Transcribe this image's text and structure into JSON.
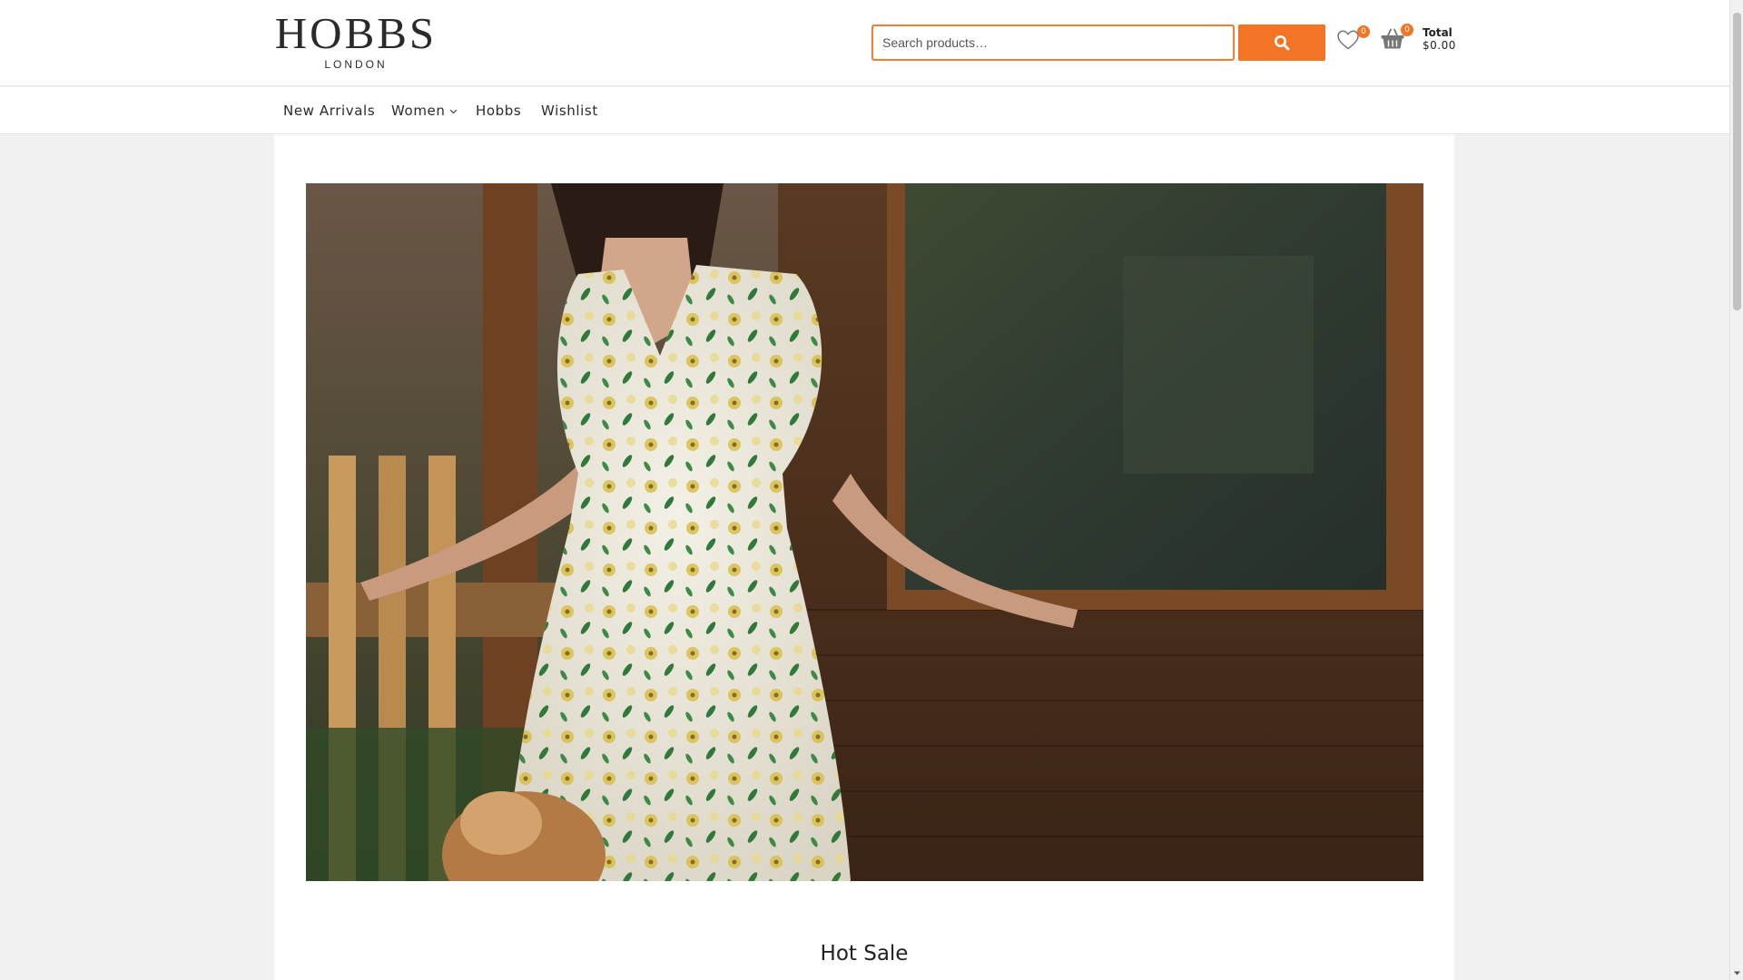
{
  "brand": {
    "name": "HOBBS",
    "subtitle": "LONDON"
  },
  "search": {
    "placeholder": "Search products…",
    "value": ""
  },
  "header": {
    "wishlist_count": "0",
    "cart_count": "0",
    "total_label": "Total",
    "total_value": "$0.00"
  },
  "nav": {
    "items": [
      {
        "label": "New Arrivals"
      },
      {
        "label": "Women"
      },
      {
        "label": "Hobbs"
      },
      {
        "label": "Wishlist"
      }
    ]
  },
  "main": {
    "section_title": "Hot Sale"
  },
  "colors": {
    "accent": "#f47425",
    "background": "#f1f1f1"
  },
  "icons": [
    "search-icon",
    "heart-icon",
    "basket-icon",
    "chevron-down-icon"
  ]
}
